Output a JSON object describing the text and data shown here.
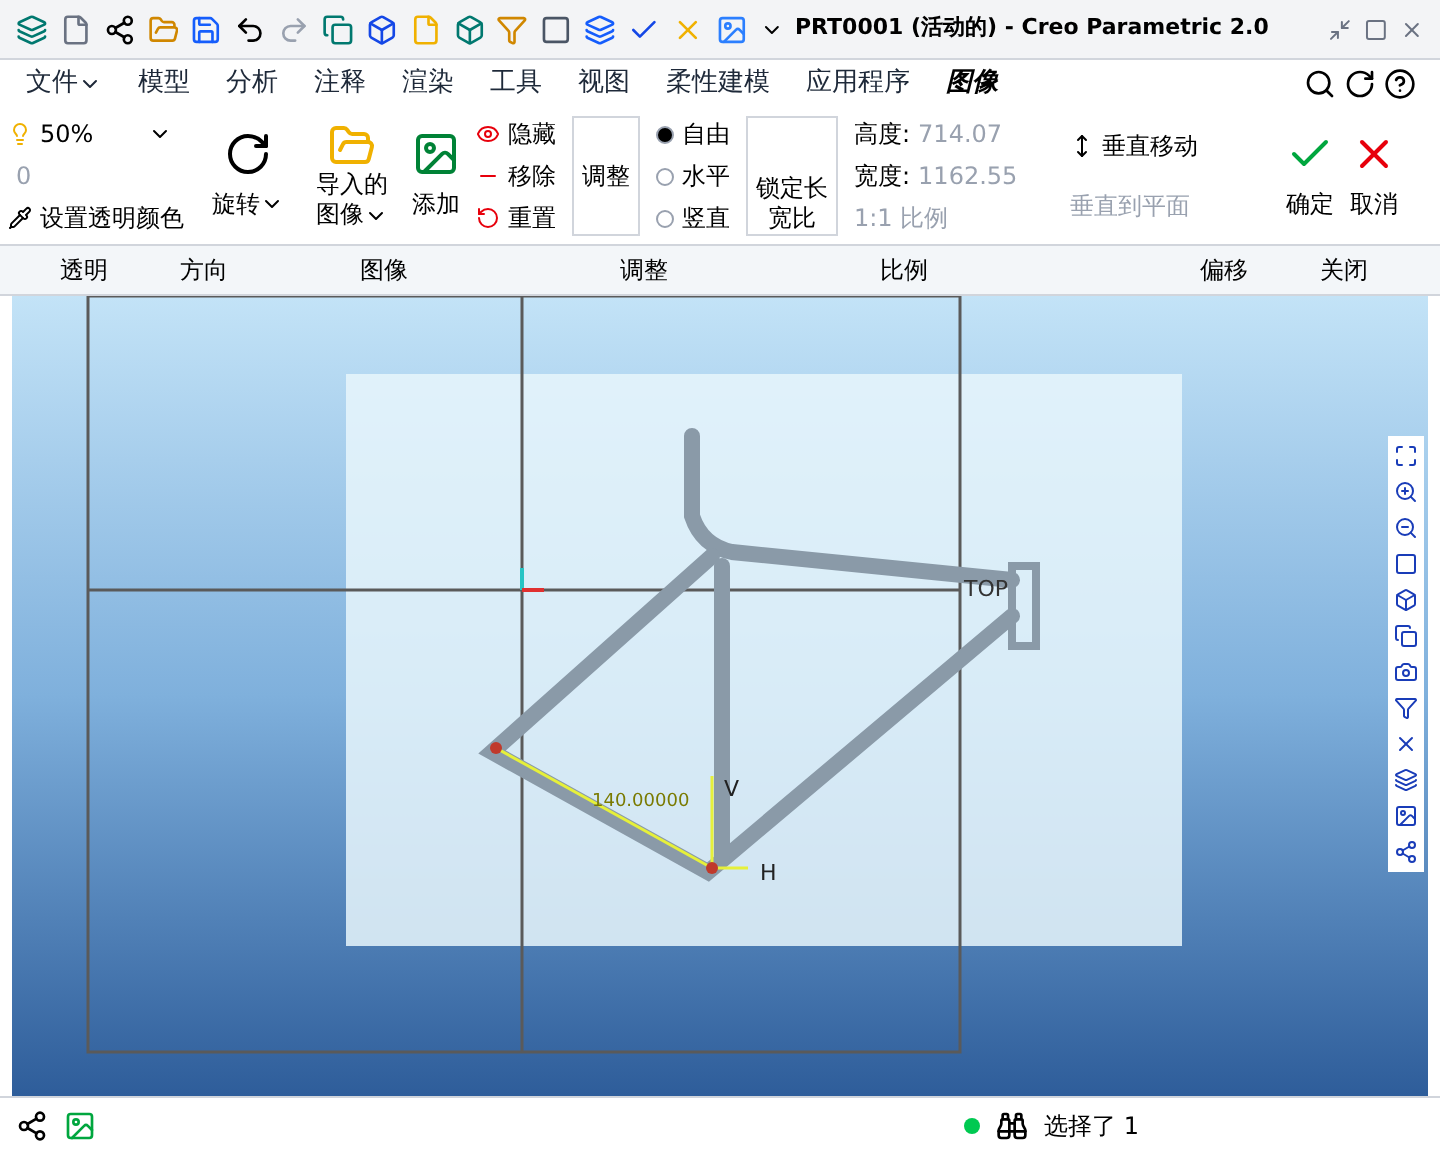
{
  "window": {
    "title": "PRT0001 (活动的) - Creo Parametric 2.0"
  },
  "menu_tabs": [
    {
      "label": "文件",
      "dropdown": true,
      "selected": false
    },
    {
      "label": "模型",
      "selected": false
    },
    {
      "label": "分析",
      "selected": false
    },
    {
      "label": "注释",
      "selected": false
    },
    {
      "label": "渲染",
      "selected": false
    },
    {
      "label": "工具",
      "selected": false
    },
    {
      "label": "视图",
      "selected": false
    },
    {
      "label": "柔性建模",
      "selected": false
    },
    {
      "label": "应用程序",
      "selected": false
    },
    {
      "label": "图像",
      "selected": true
    }
  ],
  "ribbon": {
    "transparency": {
      "value": "50%",
      "number": "0",
      "set_color": "设置透明颜色"
    },
    "rotate": "旋转",
    "import_image": [
      "导入的",
      "图像"
    ],
    "add": "添加",
    "image_actions": [
      {
        "label": "隐藏"
      },
      {
        "label": "移除"
      },
      {
        "label": "重置"
      }
    ],
    "adjust": "调整",
    "constraints": [
      {
        "label": "自由",
        "selected": true
      },
      {
        "label": "水平",
        "selected": false
      },
      {
        "label": "竖直",
        "selected": false
      }
    ],
    "lock_ratio": [
      "锁定长",
      "宽比"
    ],
    "height": {
      "label": "高度:",
      "value": "714.07",
      "disabled": true
    },
    "width": {
      "label": "宽度:",
      "value": "1162.55",
      "disabled": true
    },
    "scale_1to1": {
      "label": "1:1 比例",
      "disabled": true
    },
    "move_vertical": {
      "label": "垂直移动",
      "disabled": false
    },
    "vertical_to_plane": {
      "label": "垂直到平面",
      "disabled": true
    },
    "ok": "确定",
    "cancel": "取消"
  },
  "group_labels": [
    "透明",
    "方向",
    "图像",
    "调整",
    "比例",
    "偏移",
    "关闭"
  ],
  "canvas": {
    "plane_label": "TOP",
    "dimension": "140.00000",
    "v_label": "V",
    "h_label": "H"
  },
  "status_bar": {
    "message": "选择了 1"
  }
}
